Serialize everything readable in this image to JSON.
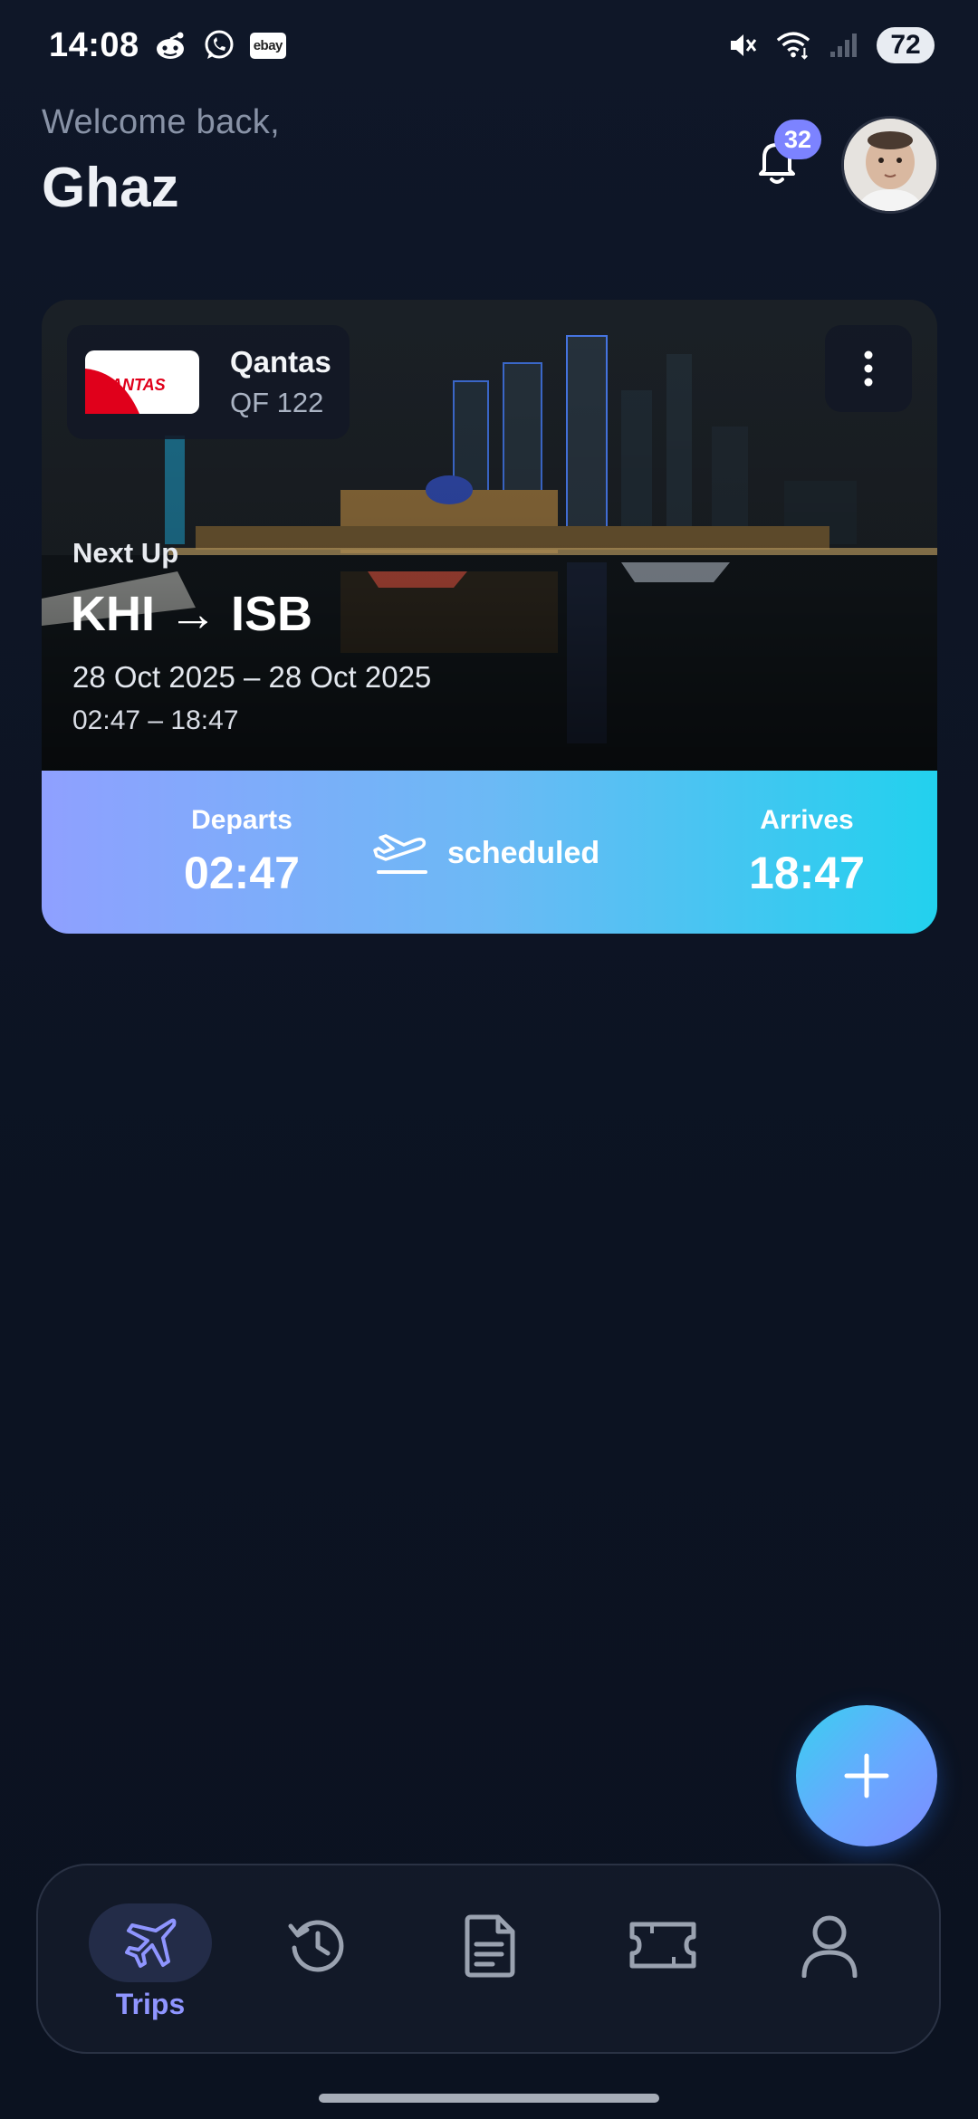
{
  "status_bar": {
    "time": "14:08",
    "notification_icons": [
      "reddit-icon",
      "whatsapp-icon",
      "ebay-icon"
    ],
    "ebay_label": "ebay",
    "right_icons": [
      "mute-icon",
      "wifi-icon",
      "signal-icon"
    ],
    "battery": "72"
  },
  "header": {
    "welcome": "Welcome back,",
    "name": "Ghaz",
    "notification_count": "32"
  },
  "trip_card": {
    "airline": "Qantas",
    "flight_number": "QF 122",
    "logo_text": "QANTAS",
    "label": "Next Up",
    "route": "KHI → ISB",
    "dates": "28 Oct 2025 – 28 Oct 2025",
    "times": "02:47 – 18:47",
    "departs_label": "Departs",
    "departs_time": "02:47",
    "status": "scheduled",
    "arrives_label": "Arrives",
    "arrives_time": "18:47"
  },
  "bottom_nav": {
    "items": [
      {
        "icon": "plane-icon",
        "label": "Trips",
        "active": true
      },
      {
        "icon": "history-icon",
        "label": "",
        "active": false
      },
      {
        "icon": "document-icon",
        "label": "",
        "active": false
      },
      {
        "icon": "ticket-icon",
        "label": "",
        "active": false
      },
      {
        "icon": "profile-icon",
        "label": "",
        "active": false
      }
    ]
  },
  "colors": {
    "background": "#0d1424",
    "accent": "#7c83ff",
    "bar_start": "#8fa0ff",
    "bar_end": "#22d1ee"
  }
}
